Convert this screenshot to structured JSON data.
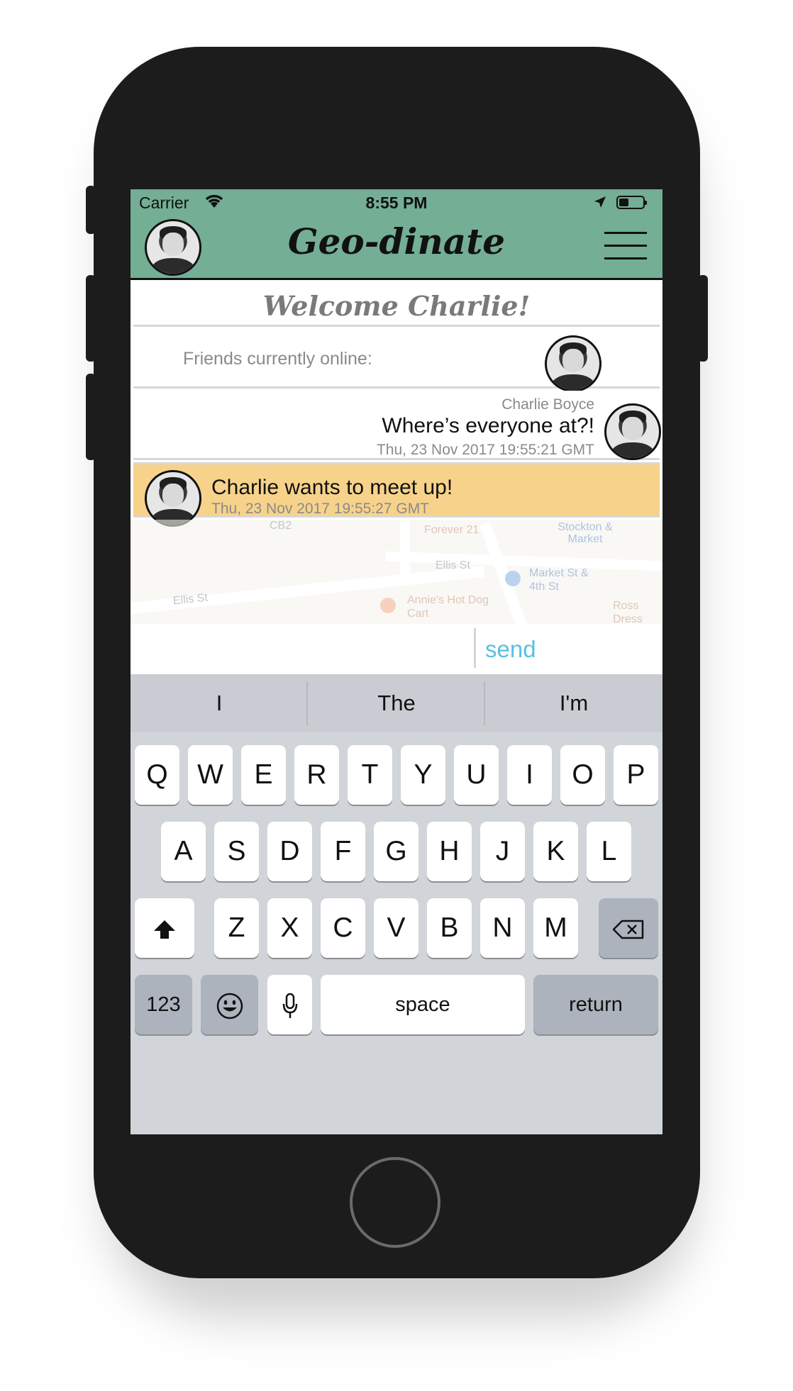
{
  "status_bar": {
    "carrier": "Carrier",
    "time": "8:55 PM"
  },
  "header": {
    "app_title": "Geo-dinate"
  },
  "welcome": {
    "text": "Welcome Charlie!"
  },
  "friends": {
    "label": "Friends currently online:"
  },
  "message": {
    "sender": "Charlie Boyce",
    "text": "Where’s everyone at?!",
    "timestamp": "Thu, 23 Nov 2017 19:55:21 GMT"
  },
  "notification": {
    "text": "Charlie wants to meet up!",
    "timestamp": "Thu, 23 Nov 2017 19:55:27 GMT"
  },
  "map": {
    "labels": [
      "CB2",
      "Forever 21",
      "Stockton & Market",
      "Ellis St",
      "Ellis St",
      "Annie's Hot Dog Cart",
      "Market St & 4th St",
      "Ross Dress For Less"
    ]
  },
  "composer": {
    "input_value": "",
    "send_label": "send"
  },
  "keyboard": {
    "suggestions": [
      "I",
      "The",
      "I'm"
    ],
    "row1": [
      "Q",
      "W",
      "E",
      "R",
      "T",
      "Y",
      "U",
      "I",
      "O",
      "P"
    ],
    "row2": [
      "A",
      "S",
      "D",
      "F",
      "G",
      "H",
      "J",
      "K",
      "L"
    ],
    "row3": [
      "Z",
      "X",
      "C",
      "V",
      "B",
      "N",
      "M"
    ],
    "numbers_label": "123",
    "space_label": "space",
    "return_label": "return"
  },
  "colors": {
    "header_bg": "#73ae95",
    "notification_bg": "#f7d28a",
    "send_color": "#59c0e0",
    "keyboard_bg": "#d1d4d9"
  },
  "icons": [
    "wifi-icon",
    "location-arrow-icon",
    "battery-icon",
    "menu-icon",
    "avatar",
    "shift-icon",
    "backspace-icon",
    "emoji-icon",
    "microphone-icon"
  ]
}
